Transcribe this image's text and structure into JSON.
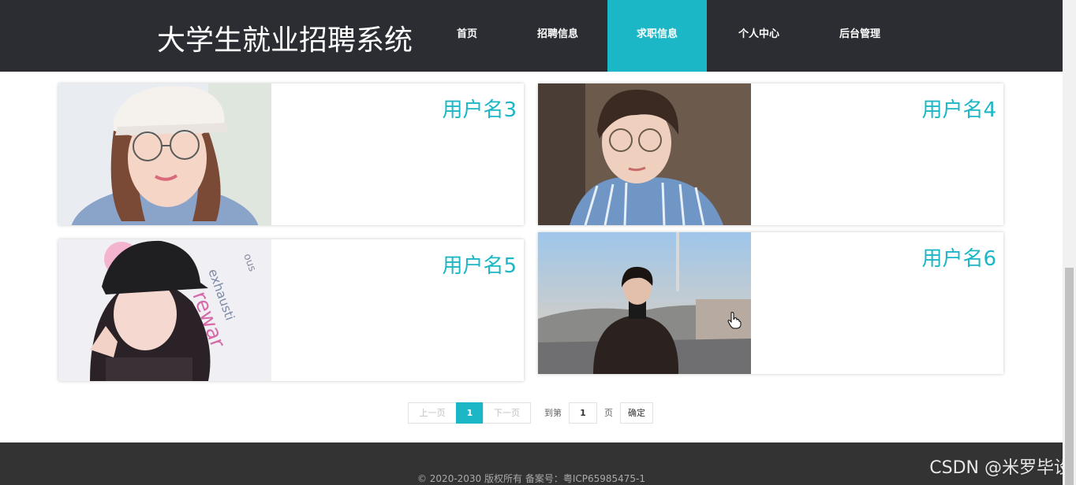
{
  "header": {
    "site_title": "大学生就业招聘系统",
    "nav": [
      {
        "label": "首页",
        "active": false
      },
      {
        "label": "招聘信息",
        "active": false
      },
      {
        "label": "求职信息",
        "active": true
      },
      {
        "label": "个人中心",
        "active": false
      },
      {
        "label": "后台管理",
        "active": false
      }
    ]
  },
  "cards": [
    {
      "username": "用户名3",
      "photo": "woman-with-white-cap-and-glasses"
    },
    {
      "username": "用户名4",
      "photo": "man-with-glasses-in-striped-shirt"
    },
    {
      "username": "用户名5",
      "photo": "woman-with-black-cap-winking"
    },
    {
      "username": "用户名6",
      "photo": "man-in-dark-coat-on-street"
    }
  ],
  "pagination": {
    "prev_label": "上一页",
    "current_page": "1",
    "next_label": "下一页",
    "goto_label": "到第",
    "page_input_value": "1",
    "page_suffix": "页",
    "confirm_label": "确定"
  },
  "footer": {
    "copyright": "© 2020-2030 版权所有 备案号：粤ICP65985475-1"
  },
  "watermark": "CSDN @米罗毕设",
  "colors": {
    "accent": "#1cb7c6",
    "header_bg": "#2b2d33",
    "footer_bg": "#333333"
  }
}
